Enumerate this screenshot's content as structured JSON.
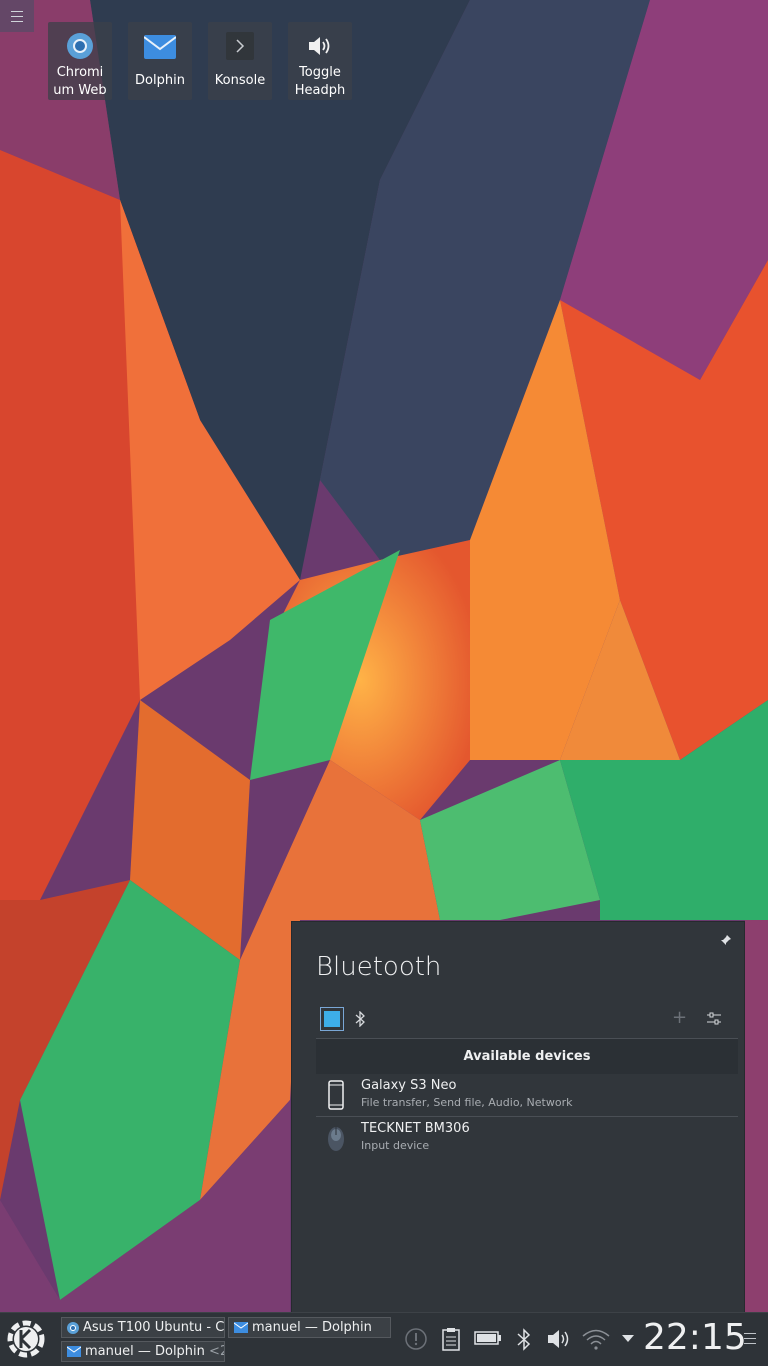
{
  "desktop": {
    "icons": [
      {
        "name": "Chromium Web",
        "label_line1": "Chromi",
        "label_line2": "um Web"
      },
      {
        "name": "Dolphin",
        "label_line1": "Dolphin"
      },
      {
        "name": "Konsole",
        "label_line1": "Konsole"
      },
      {
        "name": "Toggle Headph",
        "label_line1": "Toggle",
        "label_line2": "Headph"
      }
    ]
  },
  "bluetooth": {
    "title": "Bluetooth",
    "section_header": "Available devices",
    "enabled": true,
    "devices": [
      {
        "name": "Galaxy S3 Neo",
        "subtitle": "File transfer, Send file, Audio, Network",
        "icon": "phone-icon"
      },
      {
        "name": "TECKNET BM306",
        "subtitle": "Input device",
        "icon": "mouse-icon"
      }
    ]
  },
  "taskbar": {
    "tasks": [
      {
        "label": "Asus T100 Ubuntu - C",
        "icon": "chromium-icon"
      },
      {
        "label": "manuel — Dolphin",
        "icon": "dolphin-icon"
      },
      {
        "label": "manuel — Dolphin",
        "count": "<2",
        "icon": "dolphin-icon"
      }
    ],
    "tray": [
      "notifications-icon",
      "clipboard-icon",
      "battery-icon",
      "bluetooth-icon",
      "volume-icon",
      "wifi-icon",
      "expand-arrow-icon"
    ],
    "clock": "22:15"
  },
  "colors": {
    "accent": "#3daee9",
    "panel": "#2e3338",
    "popup": "#31363b"
  }
}
